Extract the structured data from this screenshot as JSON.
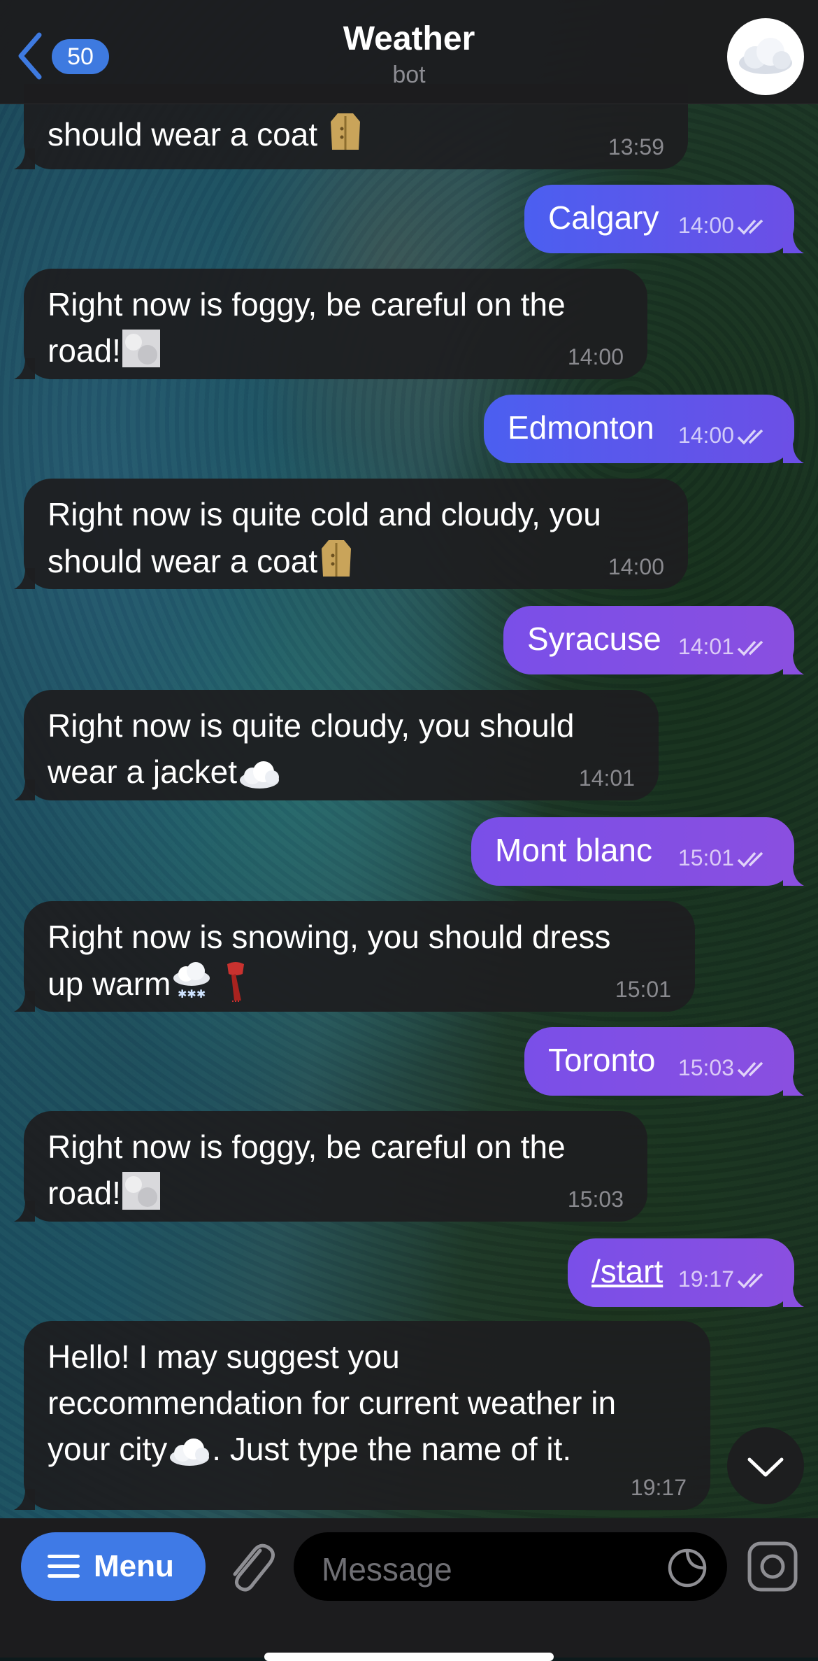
{
  "header": {
    "back_count": "50",
    "title": "Weather",
    "subtitle": "bot"
  },
  "messages": [
    {
      "side": "in",
      "text1": "should wear a coat",
      "time": "13:59",
      "emoji": "coat"
    },
    {
      "side": "out",
      "text1": "Calgary",
      "time": "14:00"
    },
    {
      "side": "in",
      "text1": "Right now is foggy, be careful on the",
      "text2": "road!",
      "time": "14:00",
      "emoji": "fog"
    },
    {
      "side": "out",
      "text1": "Edmonton",
      "time": "14:00"
    },
    {
      "side": "in",
      "text1": "Right now is quite cold and cloudy, you",
      "text2": "should wear a coat",
      "time": "14:00",
      "emoji": "coat"
    },
    {
      "side": "out",
      "text1": "Syracuse",
      "time": "14:01"
    },
    {
      "side": "in",
      "text1": "Right now is quite cloudy, you should",
      "text2": "wear a jacket",
      "time": "14:01",
      "emoji": "cloud"
    },
    {
      "side": "out",
      "text1": "Mont blanc",
      "time": "15:01"
    },
    {
      "side": "in",
      "text1": "Right now is snowing, you should dress",
      "text2": "up warm",
      "time": "15:01",
      "emoji": "snow-scarf"
    },
    {
      "side": "out",
      "text1": "Toronto",
      "time": "15:03"
    },
    {
      "side": "in",
      "text1": "Right now is foggy, be careful on the",
      "text2": "road!",
      "time": "15:03",
      "emoji": "fog"
    },
    {
      "side": "out",
      "text1": "/start",
      "time": "19:17"
    },
    {
      "side": "in",
      "text1": "Hello! I may suggest you",
      "text2": "reccommendation for current weather in",
      "text3": "your city",
      "text3b": ". Just type the name of it.",
      "time": "19:17",
      "emoji": "cloud"
    }
  ],
  "bottom": {
    "menu_label": "Menu",
    "message_placeholder": "Message"
  },
  "colors": {
    "accent": "#3f7ae6",
    "outgoing_blue": "#4b5ff0",
    "outgoing_purple": "#7a4fe8",
    "incoming": "#1e1e20"
  }
}
